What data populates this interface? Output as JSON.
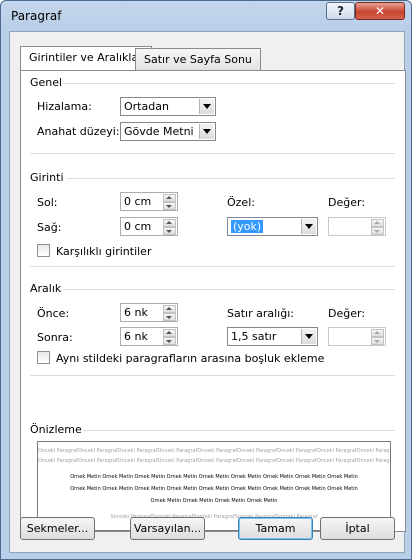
{
  "window": {
    "title": "Paragraf",
    "help_label": "?",
    "close_label": "✕"
  },
  "tabs": [
    {
      "label": "Girintiler ve Aralıklar",
      "active": true
    },
    {
      "label": "Satır ve Sayfa Sonu",
      "active": false
    }
  ],
  "general": {
    "heading": "Genel",
    "alignment_label": "Hizalama:",
    "alignment_value": "Ortadan",
    "outline_label": "Anahat düzeyi:",
    "outline_value": "Gövde Metni"
  },
  "indent": {
    "heading": "Girinti",
    "left_label": "Sol:",
    "left_value": "0 cm",
    "right_label": "Sağ:",
    "right_value": "0 cm",
    "special_label": "Özel:",
    "special_value": "(yok)",
    "by_label": "Değer:",
    "by_value": "",
    "mirror_label": "Karşılıklı girintiler"
  },
  "spacing": {
    "heading": "Aralık",
    "before_label": "Önce:",
    "before_value": "6 nk",
    "after_label": "Sonra:",
    "after_value": "6 nk",
    "line_label": "Satır aralığı:",
    "line_value": "1,5 satır",
    "at_label": "Değer:",
    "at_value": "",
    "no_space_label": "Aynı stildeki paragrafların arasına boşluk ekleme"
  },
  "preview": {
    "heading": "Önizleme",
    "prev_line": "Önceki ParagrafÖnceki ParagrafÖnceki ParagrafÖnceki ParagrafÖnceki ParagrafÖnceki ParagrafÖnceki ParagrafÖnceki ParagrafÖnceki Paragraf",
    "prev_line2": "Önceki ParagrafÖnceki ParagrafÖnceki ParagrafÖnceki ParagrafÖnceki ParagrafÖnceki ParagrafÖnceki ParagrafÖnceki ParagrafÖnceki Paragraf",
    "sample_1": "Örnek Metin Örnek Metin Örnek Metin Örnek Metin Örnek Metin Örnek Metin Örnek Metin Örnek Metin Örnek Metin",
    "sample_2": "Örnek Metin Örnek Metin Örnek Metin Örnek Metin Örnek Metin Örnek Metin Örnek Metin Örnek Metin Örnek Metin",
    "sample_3": "Örnek Metin Örnek Metin Örnek Metin Örnek Metin",
    "next_line": "Sonraki ParagrafSonraki ParagrafSonraki ParagrafSonraki ParagrafSonraki Paragraf"
  },
  "buttons": {
    "tabs": "Sekmeler...",
    "default": "Varsayılan...",
    "ok": "Tamam",
    "cancel": "İptal"
  }
}
